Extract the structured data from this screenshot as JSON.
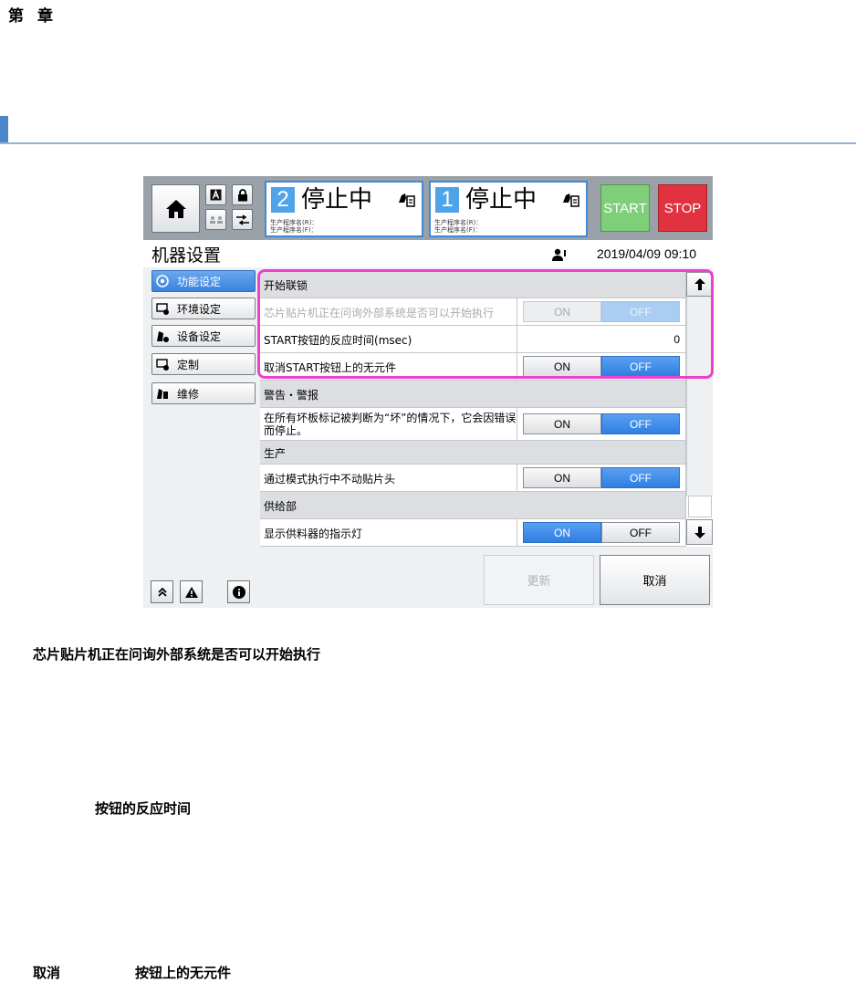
{
  "document": {
    "chapter_char1": "第",
    "chapter_char2": "章",
    "paragraph_1": "芯片贴片机正在问询外部系统是否可以开始执行",
    "paragraph_2": "按钮的反应时间",
    "paragraph_3a": "取消",
    "paragraph_3b": "按钮上的无元件"
  },
  "header": {
    "lanes": [
      {
        "number": "2",
        "status": "停止中",
        "line1": "生产程序名(R)：",
        "line2": "生产程序名(F)："
      },
      {
        "number": "1",
        "status": "停止中",
        "line1": "生产程序名(R)：",
        "line2": "生产程序名(F)："
      }
    ],
    "start_label": "START",
    "stop_label": "STOP"
  },
  "titlebar": {
    "title": "机器设置",
    "datetime": "2019/04/09 09:10"
  },
  "sidebar": {
    "items": [
      {
        "label": "功能设定",
        "active": true
      },
      {
        "label": "环境设定",
        "active": false
      },
      {
        "label": "设备设定",
        "active": false
      },
      {
        "label": "定制",
        "active": false
      },
      {
        "label": "维修",
        "active": false
      }
    ]
  },
  "settings": {
    "on_label": "ON",
    "off_label": "OFF",
    "rows": [
      {
        "type": "header",
        "label": "开始联锁"
      },
      {
        "type": "toggle",
        "label": "芯片贴片机正在问询外部系统是否可以开始执行",
        "value": "OFF",
        "disabled": true
      },
      {
        "type": "number",
        "label": "START按钮的反应时间(msec)",
        "value": "0"
      },
      {
        "type": "toggle",
        "label": "取消START按钮上的无元件",
        "value": "OFF"
      },
      {
        "type": "header",
        "label": "警告・警报"
      },
      {
        "type": "toggle",
        "label": "在所有坏板标记被判断为“坏”的情况下，它会因错误而停止。",
        "value": "OFF"
      },
      {
        "type": "header",
        "label": "生产"
      },
      {
        "type": "toggle",
        "label": "通过模式执行中不动贴片头",
        "value": "OFF"
      },
      {
        "type": "header",
        "label": "供给部"
      },
      {
        "type": "toggle",
        "label": "显示供料器的指示灯",
        "value": "ON"
      }
    ]
  },
  "footer": {
    "update_label": "更新",
    "cancel_label": "取消"
  },
  "colors": {
    "accent_blue": "#3a82dc",
    "highlight": "#ee3fcf",
    "start": "#7fcf7a",
    "stop": "#e0333f"
  }
}
